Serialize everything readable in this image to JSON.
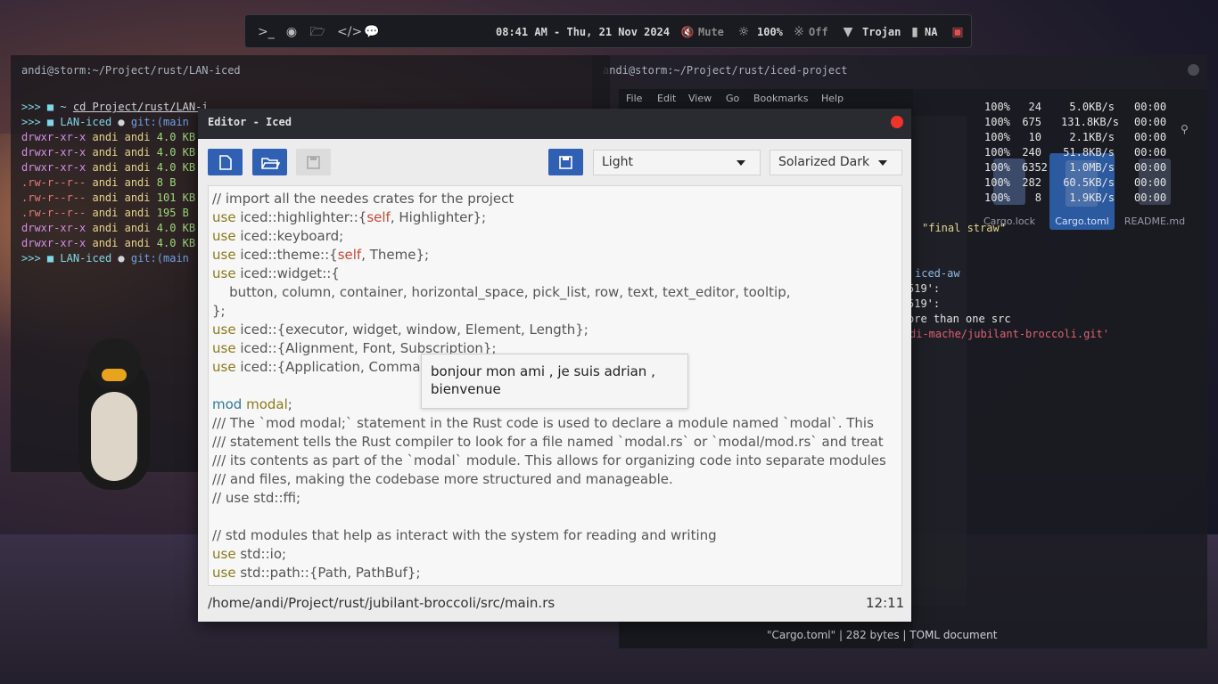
{
  "topbar": {
    "datetime": "08:41 AM - Thu, 21 Nov 2024",
    "volume": "Mute",
    "brightness": "100%",
    "bluetooth": "Off",
    "wifi": "Trojan",
    "battery": "NA"
  },
  "term_left": {
    "title": "andi@storm:~/Project/rust/LAN-iced",
    "lines": [
      {
        "prompt": ">>>",
        "dir": "~",
        "text": "cd Project/rust/LAN-i"
      },
      {
        "prompt": ">>>",
        "dir": "LAN-iced",
        "git": "git:(main"
      },
      {
        "perm": "drwxr-xr-x",
        "user": "andi andi",
        "size": "4.0 KB"
      },
      {
        "perm": "drwxr-xr-x",
        "user": "andi andi",
        "size": "4.0 KB"
      },
      {
        "perm": "drwxr-xr-x",
        "user": "andi andi",
        "size": "4.0 KB"
      },
      {
        "perm": ".rw-r--r--",
        "user": "andi andi",
        "size": "8 B"
      },
      {
        "perm": ".rw-r--r--",
        "user": "andi andi",
        "size": "101 KB"
      },
      {
        "perm": ".rw-r--r--",
        "user": "andi andi",
        "size": "195 B"
      },
      {
        "perm": "drwxr-xr-x",
        "user": "andi andi",
        "size": "4.0 KB"
      },
      {
        "perm": "drwxr-xr-x",
        "user": "andi andi",
        "size": "4.0 KB"
      },
      {
        "prompt": ">>>",
        "dir": "LAN-iced",
        "git": "git:(main"
      }
    ]
  },
  "term_right": {
    "title": "andi@storm:~/Project/rust/iced-project",
    "rows": [
      [
        "100%",
        "24",
        "5.0KB/s",
        "00:00"
      ],
      [
        "100%",
        "675",
        "131.8KB/s",
        "00:00"
      ],
      [
        "100%",
        "10",
        "2.1KB/s",
        "00:00"
      ],
      [
        "100%",
        "240",
        "51.8KB/s",
        "00:00"
      ],
      [
        "100%",
        "6352",
        "1.0MB/s",
        "00:00"
      ],
      [
        "100%",
        "282",
        "60.5KB/s",
        "00:00"
      ],
      [
        "100%",
        "8",
        "1.9KB/s",
        "00:00"
      ]
    ],
    "snippets": [
      "\"final straw\"",
      "iced-aw",
      "519':",
      "519':",
      "ore than one src",
      "di-mache/jubilant-broccoli.git'"
    ]
  },
  "file_manager": {
    "menu": [
      "File",
      "Edit",
      "View",
      "Go",
      "Bookmarks",
      "Help"
    ],
    "files": [
      "Cargo.lock",
      "Cargo.toml",
      "README.md"
    ],
    "status": "\"Cargo.toml\"  |  282 bytes  |  TOML document"
  },
  "editor": {
    "title": "Editor - Iced",
    "language_pick": "Light",
    "theme_pick": "Solarized Dark",
    "code": [
      "// import all the needes crates for the project",
      "use iced::highlighter::{self, Highlighter};",
      "use iced::keyboard;",
      "use iced::theme::{self, Theme};",
      "use iced::widget::{",
      "    button, column, container, horizontal_space, pick_list, row, text, text_editor, tooltip,",
      "};",
      "use iced::{executor, widget, window, Element, Length};",
      "use iced::{Alignment, Font, Subscription};",
      "use iced::{Application, Comman",
      "",
      "mod modal;",
      "/// The `mod modal;` statement in the Rust code is used to declare a module named `modal`. This",
      "/// statement tells the Rust compiler to look for a file named `modal.rs` or `modal/mod.rs` and treat",
      "/// its contents as part of the `modal` module. This allows for organizing code into separate modules",
      "/// and files, making the codebase more structured and manageable.",
      "// use std::ffi;",
      "",
      "// std modules that help as interact with the system for reading and writing",
      "use std::io;",
      "use std::path::{Path, PathBuf};"
    ],
    "tooltip": "bonjour mon ami , je suis adrian , bienvenue",
    "file_path": "/home/andi/Project/rust/jubilant-broccoli/src/main.rs",
    "cursor_position": "12:11"
  }
}
